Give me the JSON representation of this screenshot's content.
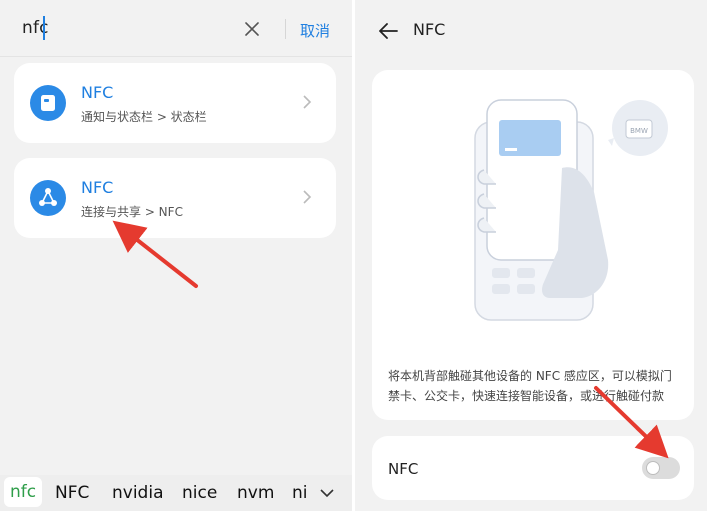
{
  "search": {
    "query": "nfc",
    "cancel_label": "取消",
    "clear_icon": "close-icon"
  },
  "results": [
    {
      "title": "NFC",
      "subtitle": "通知与状态栏 > 状态栏",
      "icon": "status-bar-icon"
    },
    {
      "title": "NFC",
      "subtitle": "连接与共享 > NFC",
      "icon": "share-icon"
    }
  ],
  "keyboard": {
    "suggestions": [
      "nfc",
      "NFC",
      "nvidia",
      "nice",
      "nvm",
      "ni"
    ],
    "expand_icon": "chevron-down-icon"
  },
  "settings": {
    "title": "NFC",
    "description": "将本机背部触碰其他设备的 NFC 感应区，可以模拟门禁卡、公交卡，快速连接智能设备，或进行触碰付款",
    "toggle_label": "NFC",
    "toggle_on": false,
    "illustration_badge": "BMW"
  },
  "colors": {
    "accent": "#1f7fe0",
    "icon_bg": "#2b8ae6",
    "annotation_arrow": "#e53a2f",
    "suggestion_active": "#2f9e4a"
  }
}
